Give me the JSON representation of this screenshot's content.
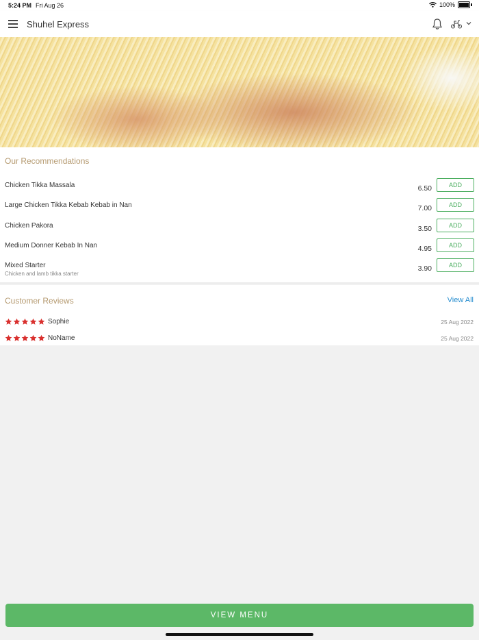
{
  "status_bar": {
    "time": "5:24 PM",
    "date": "Fri Aug 26",
    "battery": "100%"
  },
  "header": {
    "title": "Shuhel Express"
  },
  "icons": {
    "menu": "hamburger-menu-icon",
    "notifications": "bell-icon",
    "delivery": "scooter-icon",
    "dropdown": "chevron-down-icon"
  },
  "recommendations": {
    "title": "Our Recommendations",
    "add_label": "ADD",
    "items": [
      {
        "name": "Chicken Tikka Massala",
        "description": "",
        "price": "6.50"
      },
      {
        "name": "Large Chicken Tikka Kebab Kebab in Nan",
        "description": "",
        "price": "7.00"
      },
      {
        "name": "Chicken Pakora",
        "description": "",
        "price": "3.50"
      },
      {
        "name": "Medium Donner Kebab In Nan",
        "description": "",
        "price": "4.95"
      },
      {
        "name": "Mixed Starter",
        "description": "Chicken and lamb tikka starter",
        "price": "3.90"
      }
    ]
  },
  "reviews": {
    "title": "Customer Reviews",
    "view_all": "View All",
    "items": [
      {
        "name": "Sophie",
        "rating": 5,
        "date": "25 Aug 2022"
      },
      {
        "name": "NoName",
        "rating": 5,
        "date": "25 Aug 2022"
      }
    ]
  },
  "colors": {
    "accent_green": "#5cb867",
    "star_red": "#d9302e",
    "section_title": "#b59a70",
    "link_blue": "#2a8fd0"
  },
  "footer": {
    "view_menu_label": "VIEW MENU"
  }
}
